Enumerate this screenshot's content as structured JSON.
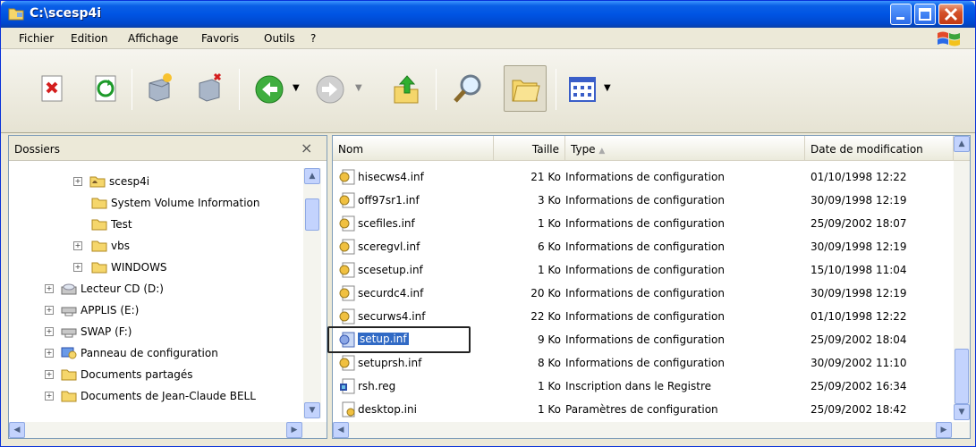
{
  "window": {
    "title": "C:\\scesp4i"
  },
  "menu": {
    "fichier": "Fichier",
    "edition": "Edition",
    "affichage": "Affichage",
    "favoris": "Favoris",
    "outils": "Outils",
    "aide": "?"
  },
  "toolbar": {
    "icons": [
      "delete-file-icon",
      "refresh-icon",
      "map-drive-icon",
      "disconnect-drive-icon",
      "back-icon",
      "forward-icon",
      "up-icon",
      "search-icon",
      "folders-icon",
      "views-icon"
    ]
  },
  "folders": {
    "title": "Dossiers",
    "close": "×",
    "items": [
      {
        "label": "scesp4i"
      },
      {
        "label": "System Volume Information"
      },
      {
        "label": "Test"
      },
      {
        "label": "vbs"
      },
      {
        "label": "WINDOWS"
      },
      {
        "label": "Lecteur CD (D:)"
      },
      {
        "label": "APPLIS (E:)"
      },
      {
        "label": "SWAP (F:)"
      },
      {
        "label": "Panneau de configuration"
      },
      {
        "label": "Documents partagés"
      },
      {
        "label": "Documents de Jean-Claude BELL"
      }
    ]
  },
  "files": {
    "columns": {
      "name": "Nom",
      "size": "Taille",
      "type": "Type",
      "sort_indicator": "▲",
      "date": "Date de modification"
    },
    "rows": [
      {
        "name": "hisecws4.inf",
        "size": "21 Ko",
        "type": "Informations de configuration",
        "date": "01/10/1998 12:22"
      },
      {
        "name": "off97sr1.inf",
        "size": "3 Ko",
        "type": "Informations de configuration",
        "date": "30/09/1998 12:19"
      },
      {
        "name": "scefiles.inf",
        "size": "1 Ko",
        "type": "Informations de configuration",
        "date": "25/09/2002 18:07"
      },
      {
        "name": "sceregvl.inf",
        "size": "6 Ko",
        "type": "Informations de configuration",
        "date": "30/09/1998 12:19"
      },
      {
        "name": "scesetup.inf",
        "size": "1 Ko",
        "type": "Informations de configuration",
        "date": "15/10/1998 11:04"
      },
      {
        "name": "securdc4.inf",
        "size": "20 Ko",
        "type": "Informations de configuration",
        "date": "30/09/1998 12:19"
      },
      {
        "name": "securws4.inf",
        "size": "22 Ko",
        "type": "Informations de configuration",
        "date": "01/10/1998 12:22"
      },
      {
        "name": "setup.inf",
        "size": "9 Ko",
        "type": "Informations de configuration",
        "date": "25/09/2002 18:04"
      },
      {
        "name": "setuprsh.inf",
        "size": "8 Ko",
        "type": "Informations de configuration",
        "date": "30/09/2002 11:10"
      },
      {
        "name": "rsh.reg",
        "size": "1 Ko",
        "type": "Inscription dans le Registre",
        "date": "25/09/2002 16:34"
      },
      {
        "name": "desktop.ini",
        "size": "1 Ko",
        "type": "Paramètres de configuration",
        "date": "25/09/2002 18:42"
      }
    ]
  },
  "colors": {
    "title_bar": "#0054e3",
    "selection": "#316ac5",
    "folder": "#f5d66b"
  }
}
